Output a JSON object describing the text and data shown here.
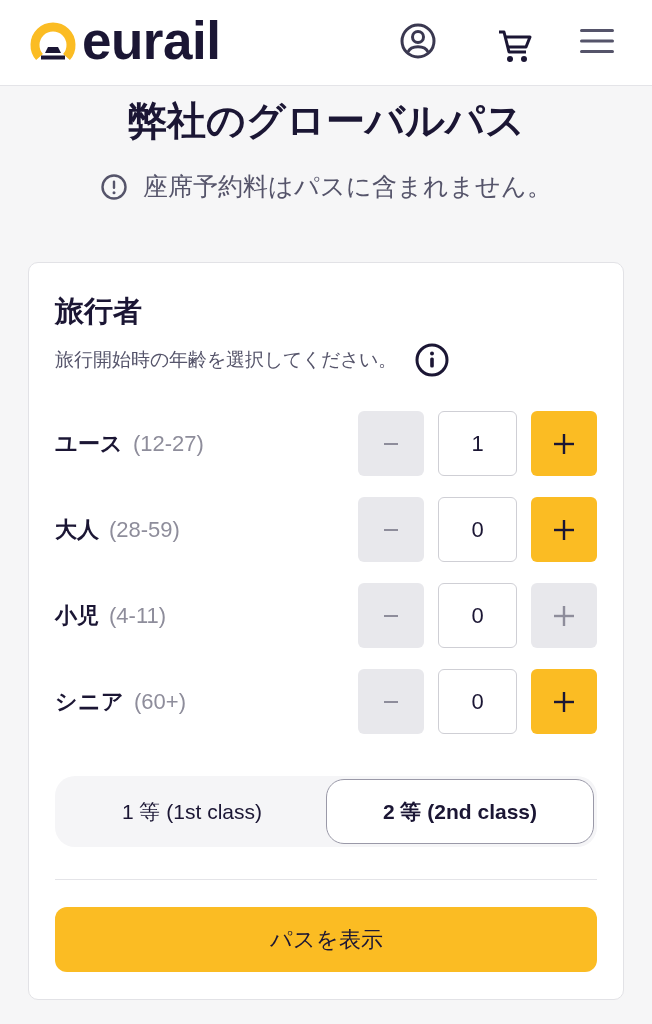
{
  "header": {
    "logo_text": "eurail"
  },
  "page_title": "弊社のグローバルパス",
  "notice": "座席予約料はパスに含まれません。",
  "travelers": {
    "title": "旅行者",
    "hint": "旅行開始時の年齢を選択してください。",
    "rows": [
      {
        "label": "ユース",
        "range": "(12-27)",
        "value": "1",
        "minus_disabled": true,
        "plus_disabled": false
      },
      {
        "label": "大人",
        "range": "(28-59)",
        "value": "0",
        "minus_disabled": true,
        "plus_disabled": false
      },
      {
        "label": "小児",
        "range": "(4-11)",
        "value": "0",
        "minus_disabled": true,
        "plus_disabled": true
      },
      {
        "label": "シニア",
        "range": "(60+)",
        "value": "0",
        "minus_disabled": true,
        "plus_disabled": false
      }
    ]
  },
  "class_options": [
    {
      "label": "1 等 (1st class)",
      "selected": false
    },
    {
      "label": "2 等 (2nd class)",
      "selected": true
    }
  ],
  "submit_button": "パスを表示"
}
